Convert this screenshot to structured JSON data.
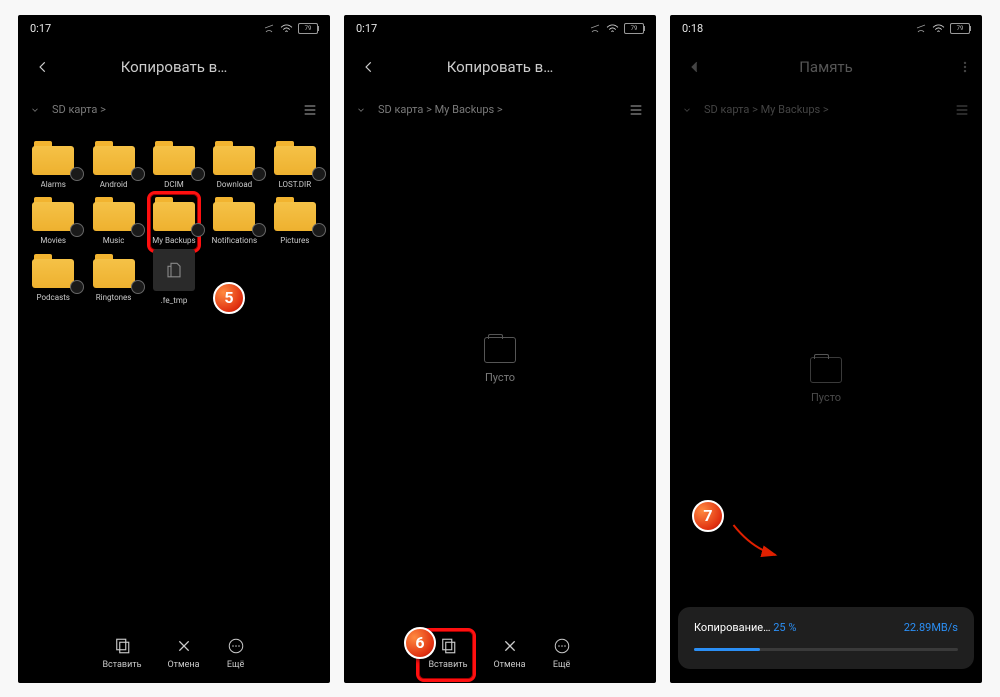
{
  "screens": [
    {
      "time": "0:17",
      "battery": "79",
      "title": "Копировать в…",
      "breadcrumb": [
        "SD карта"
      ],
      "folders": [
        {
          "label": "Alarms",
          "type": "folder"
        },
        {
          "label": "Android",
          "type": "folder"
        },
        {
          "label": "DCIM",
          "type": "folder"
        },
        {
          "label": "Download",
          "type": "folder"
        },
        {
          "label": "LOST.DIR",
          "type": "folder"
        },
        {
          "label": "Movies",
          "type": "folder"
        },
        {
          "label": "Music",
          "type": "folder"
        },
        {
          "label": "My Backups",
          "type": "folder",
          "highlight": true
        },
        {
          "label": "Notifications",
          "type": "folder"
        },
        {
          "label": "Pictures",
          "type": "folder"
        },
        {
          "label": "Podcasts",
          "type": "folder"
        },
        {
          "label": "Ringtones",
          "type": "folder"
        },
        {
          "label": ".fe_tmp",
          "type": "file"
        }
      ],
      "bottom": [
        {
          "label": "Вставить",
          "icon": "paste"
        },
        {
          "label": "Отмена",
          "icon": "close"
        },
        {
          "label": "Ещё",
          "icon": "more"
        }
      ],
      "badge": "5"
    },
    {
      "time": "0:17",
      "battery": "79",
      "title": "Копировать в…",
      "breadcrumb": [
        "SD карта",
        "My Backups"
      ],
      "empty_label": "Пусто",
      "bottom": [
        {
          "label": "Вставить",
          "icon": "paste",
          "highlight": true
        },
        {
          "label": "Отмена",
          "icon": "close"
        },
        {
          "label": "Ещё",
          "icon": "more"
        }
      ],
      "badge": "6"
    },
    {
      "time": "0:18",
      "battery": "79",
      "title": "Память",
      "has_more": true,
      "breadcrumb": [
        "SD карта",
        "My Backups"
      ],
      "empty_label": "Пусто",
      "dimmed": true,
      "progress": {
        "label": "Копирование…",
        "percent_text": "25 %",
        "percent": 25,
        "speed": "22.89MB/s"
      },
      "badge": "7"
    }
  ]
}
